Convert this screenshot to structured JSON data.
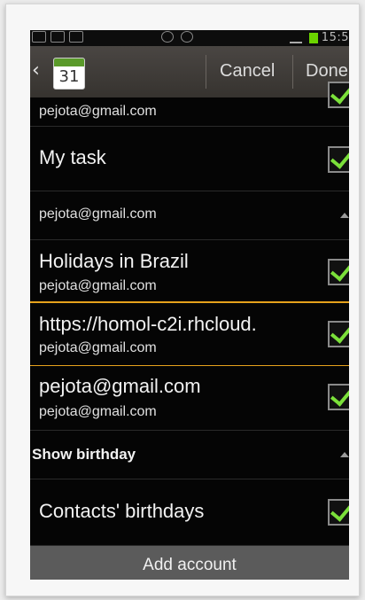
{
  "status_bar": {
    "time": "15:5"
  },
  "action_bar": {
    "calendar_day": "31",
    "cancel_label": "Cancel",
    "done_label": "Done"
  },
  "list": {
    "top_partial_account": "pejota@gmail.com",
    "items": [
      {
        "title": "My task"
      },
      {
        "title": "pejota@gmail.com"
      },
      {
        "title": "Holidays in Brazil",
        "subtitle": "pejota@gmail.com"
      },
      {
        "title": "https://homol-c2i.rhcloud.",
        "subtitle": "pejota@gmail.com"
      },
      {
        "title": "pejota@gmail.com",
        "subtitle": "pejota@gmail.com"
      },
      {
        "title": "Show birthday"
      },
      {
        "title": "Contacts' birthdays"
      }
    ]
  },
  "footer": {
    "add_account_label": "Add account"
  },
  "colors": {
    "check": "#7be03a",
    "highlight": "#e6a21c",
    "calendar_green": "#5a9a2a"
  }
}
